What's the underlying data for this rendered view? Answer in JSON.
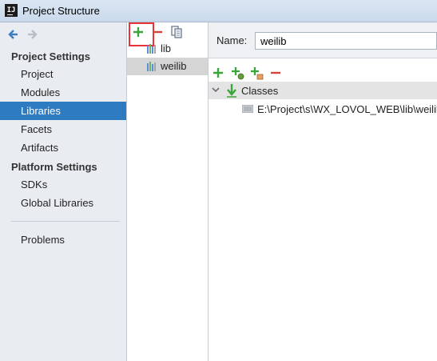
{
  "window": {
    "title": "Project Structure",
    "app_icon_text": "IJ"
  },
  "sidebar": {
    "back_icon": "arrow-left-icon",
    "forward_icon": "arrow-right-icon",
    "project_settings_heading": "Project Settings",
    "project_settings_items": [
      {
        "label": "Project"
      },
      {
        "label": "Modules"
      },
      {
        "label": "Libraries",
        "selected": true
      },
      {
        "label": "Facets"
      },
      {
        "label": "Artifacts"
      }
    ],
    "platform_settings_heading": "Platform Settings",
    "platform_settings_items": [
      {
        "label": "SDKs"
      },
      {
        "label": "Global Libraries"
      }
    ],
    "problems_label": "Problems"
  },
  "libraries_panel": {
    "toolbar": [
      "add-icon",
      "remove-icon",
      "copy-icon"
    ],
    "items": [
      {
        "label": "lib",
        "selected": false
      },
      {
        "label": "weilib",
        "selected": true
      }
    ]
  },
  "detail": {
    "name_label": "Name:",
    "name_value": "weilib",
    "toolbar": [
      "add-icon",
      "add-special-icon",
      "attach-icon",
      "remove-icon"
    ],
    "tree": {
      "root_label": "Classes",
      "children": [
        {
          "label": "E:\\Project\\s\\WX_LOVOL_WEB\\lib\\weilib"
        }
      ]
    }
  },
  "colors": {
    "selection": "#2f7bc1",
    "add": "#3aa53a",
    "remove": "#d6423c",
    "highlight": "#e8333a"
  }
}
